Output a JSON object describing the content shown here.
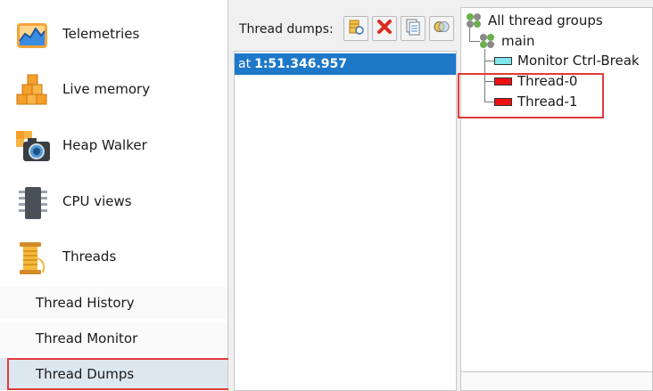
{
  "sidebar": {
    "items": [
      {
        "label": "Telemetries",
        "icon": "telemetries-icon"
      },
      {
        "label": "Live memory",
        "icon": "live-memory-icon"
      },
      {
        "label": "Heap Walker",
        "icon": "heap-walker-icon"
      },
      {
        "label": "CPU views",
        "icon": "cpu-views-icon"
      },
      {
        "label": "Threads",
        "icon": "threads-icon"
      }
    ],
    "sub_items": [
      {
        "label": "Thread History"
      },
      {
        "label": "Thread Monitor"
      },
      {
        "label": "Thread Dumps",
        "selected": true
      }
    ]
  },
  "toolbar": {
    "label": "Thread dumps:",
    "buttons": [
      {
        "icon": "take-dump-icon"
      },
      {
        "icon": "delete-icon"
      },
      {
        "icon": "copy-icon"
      },
      {
        "icon": "compare-icon"
      }
    ]
  },
  "dumps": {
    "rows": [
      {
        "prefix": "at",
        "time": "1:51.346.957",
        "selected": true
      }
    ]
  },
  "tree": {
    "root": "All thread groups",
    "group": "main",
    "threads": [
      {
        "name": "Monitor Ctrl-Break",
        "color": "#7fe6ee"
      },
      {
        "name": "Thread-0",
        "color": "#ee1111"
      },
      {
        "name": "Thread-1",
        "color": "#ee1111"
      }
    ]
  },
  "colors": {
    "selection": "#1e78c8",
    "highlight_frame": "#e03a3a"
  }
}
